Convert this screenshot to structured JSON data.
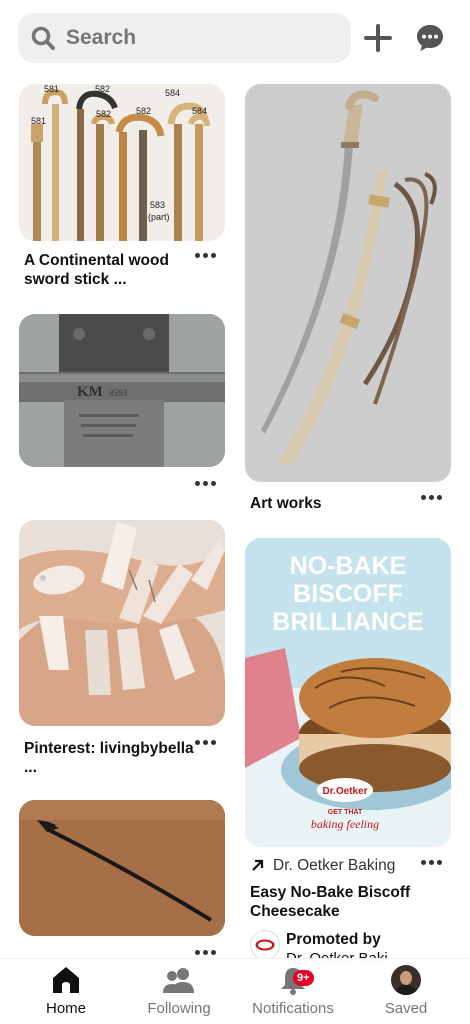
{
  "search": {
    "placeholder": "Search"
  },
  "header": {
    "add_icon": "plus-icon",
    "messages_icon": "chat-bubble-icon"
  },
  "pins": [
    {
      "title": "A Continental wood sword stick ...",
      "image_labels": [
        "581",
        "582",
        "581",
        "582",
        "582",
        "584",
        "584",
        "583",
        "(part)"
      ]
    },
    {
      "title": ""
    },
    {
      "title": "Pinterest: livingbybella ..."
    },
    {
      "title": ""
    },
    {
      "title": "Art works"
    },
    {
      "image_text": {
        "line1": "NO-BAKE",
        "line2": "BISCOFF",
        "line3": "BRILLIANCE",
        "brand": "Dr.Oetker",
        "tagline1": "GET THAT",
        "tagline2": "baking feeling"
      },
      "source": "Dr. Oetker Baking",
      "title": "Easy No-Bake Biscoff Cheesecake",
      "promoted_by_label": "Promoted by",
      "promoter": "Dr. Oetker Baki"
    }
  ],
  "nav": {
    "home": "Home",
    "following": "Following",
    "notifications": "Notifications",
    "notifications_badge": "9+",
    "saved": "Saved"
  },
  "colors": {
    "accent": "#e60023",
    "search_bg": "#efefef"
  }
}
